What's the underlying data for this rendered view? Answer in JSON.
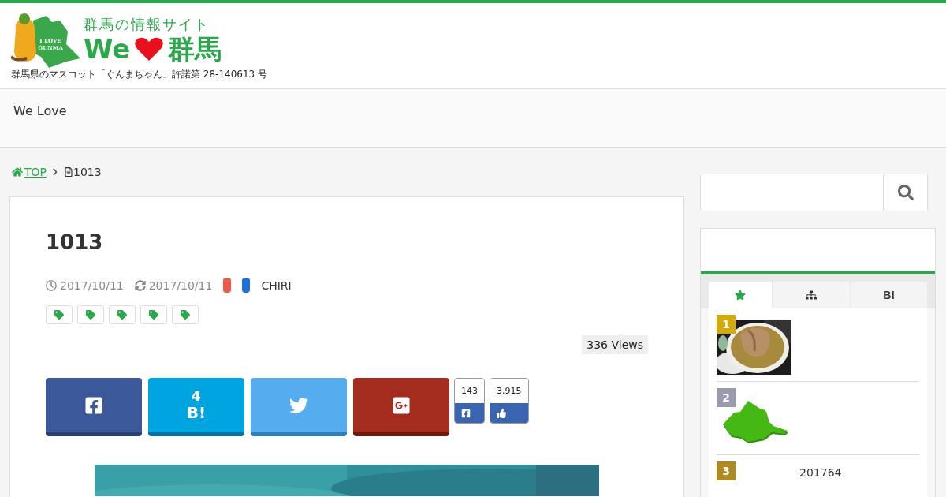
{
  "header": {
    "logo": {
      "tagline": "群馬の情報サイト",
      "we": "We",
      "gunma": "群馬",
      "badge_line1": "I LOVE",
      "badge_line2": "GUNMA",
      "caption": "群馬県のマスコット「ぐんまちゃん」許諾第 28-140613 号"
    }
  },
  "nav": {
    "items": [
      "We Love"
    ]
  },
  "breadcrumb": {
    "home": "TOP",
    "current": "1013"
  },
  "article": {
    "title": "1013",
    "published": "2017/10/11",
    "updated": "2017/10/11",
    "categories": [
      {
        "color": "#ee5a4a"
      },
      {
        "color": "#1f6fd4"
      }
    ],
    "author": "CHIRI",
    "tags": [
      {
        "kind": "tag"
      },
      {
        "kind": "tag"
      },
      {
        "kind": "tag"
      },
      {
        "kind": "tag"
      },
      {
        "kind": "tag"
      }
    ],
    "views": "336 Views",
    "share": [
      {
        "kind": "facebook"
      },
      {
        "kind": "hatena",
        "count": "4",
        "label": "B!"
      },
      {
        "kind": "twitter"
      },
      {
        "kind": "googleplus"
      }
    ],
    "counters": [
      {
        "kind": "share",
        "count": "143"
      },
      {
        "kind": "like",
        "count": "3,915"
      }
    ]
  },
  "sidebar": {
    "tabs": [
      {
        "kind": "star",
        "selected": true
      },
      {
        "kind": "sitemap",
        "selected": false
      },
      {
        "kind": "hatena",
        "label": "B!",
        "selected": false
      }
    ],
    "ranking": [
      {
        "rank": "1",
        "color": "#d4a90c",
        "kind": "picture"
      },
      {
        "rank": "2",
        "color": "#9a9aae",
        "kind": "map"
      },
      {
        "rank": "3",
        "color": "#b08a20",
        "title": "201764"
      }
    ]
  }
}
